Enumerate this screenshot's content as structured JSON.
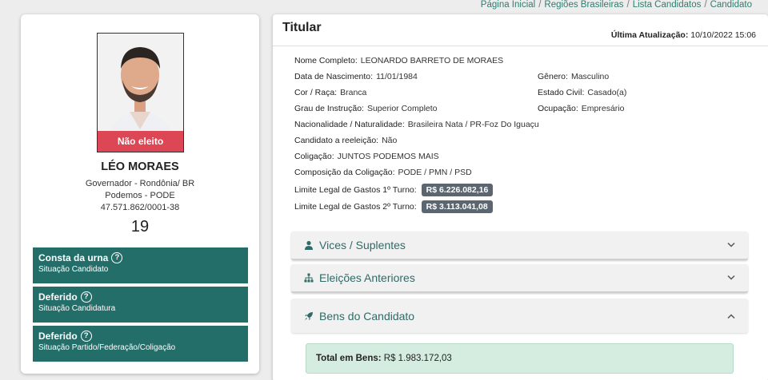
{
  "breadcrumb": [
    "Página Inicial",
    "Regiões Brasileiras",
    "Lista Candidatos",
    "Candidato"
  ],
  "candidate": {
    "photo_badge": "Não eleito",
    "name": "LÉO MORAES",
    "office": "Governador - Rondônia/ BR",
    "party": "Podemos - PODE",
    "cnpj": "47.571.862/0001-38",
    "number": "19"
  },
  "status": [
    {
      "title": "Consta da urna",
      "subtitle": "Situação Candidato"
    },
    {
      "title": "Deferido",
      "subtitle": "Situação Candidatura"
    },
    {
      "title": "Deferido",
      "subtitle": "Situação Partido/Federação/Coligação"
    }
  ],
  "details": {
    "title": "Titular",
    "last_update_label": "Última Atualização:",
    "last_update_value": "10/10/2022 15:06",
    "fields": {
      "full_name": {
        "label": "Nome Completo:",
        "value": "LEONARDO BARRETO DE MORAES"
      },
      "birth": {
        "label": "Data de Nascimento:",
        "value": "11/01/1984"
      },
      "gender": {
        "label": "Gênero:",
        "value": "Masculino"
      },
      "race": {
        "label": "Cor / Raça:",
        "value": "Branca"
      },
      "civil": {
        "label": "Estado Civil:",
        "value": "Casado(a)"
      },
      "education": {
        "label": "Grau de Instrução:",
        "value": "Superior Completo"
      },
      "occupation": {
        "label": "Ocupação:",
        "value": "Empresário"
      },
      "nationality": {
        "label": "Nacionalidade / Naturalidade:",
        "value": "Brasileira Nata / PR-Foz Do Iguaçu"
      },
      "reelection": {
        "label": "Candidato a reeleição:",
        "value": "Não"
      },
      "coalition": {
        "label": "Coligação:",
        "value": "JUNTOS PODEMOS MAIS"
      },
      "coalition_comp": {
        "label": "Composição da Coligação:",
        "value": "PODE / PMN / PSD"
      },
      "limit1": {
        "label": "Limite Legal de Gastos 1º Turno:",
        "value": "R$ 6.226.082,16"
      },
      "limit2": {
        "label": "Limite Legal de Gastos 2º Turno:",
        "value": "R$ 3.113.041,08"
      }
    }
  },
  "accordions": {
    "vices": "Vices / Suplentes",
    "previous": "Eleições Anteriores",
    "assets": "Bens do Candidato"
  },
  "assets": {
    "total_label": "Total em Bens:",
    "total_value": "R$ 1.983.172,03"
  },
  "colors": {
    "accent": "#246e6a",
    "not_elected": "#dc4655",
    "link": "#2e7d6e"
  }
}
